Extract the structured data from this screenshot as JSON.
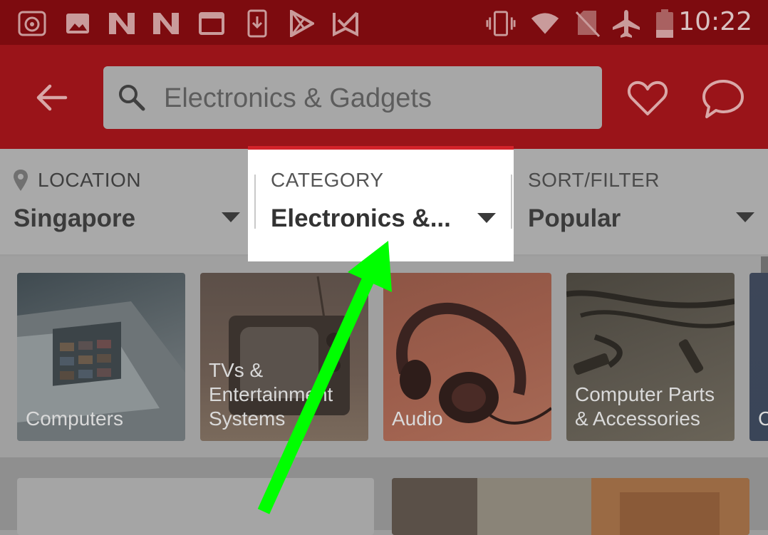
{
  "status_bar": {
    "time": "10:22",
    "left_icons": [
      "camera-app-icon",
      "image-icon",
      "n-icon",
      "n-icon",
      "window-icon",
      "download-icon",
      "play-store-icon",
      "check-icon"
    ],
    "right_icons": [
      "vibrate-icon",
      "wifi-icon",
      "no-sim-icon",
      "airplane-mode-icon",
      "battery-icon"
    ]
  },
  "app_bar": {
    "search_value": "Electronics & Gadgets"
  },
  "filters": {
    "location": {
      "label": "LOCATION",
      "value": "Singapore"
    },
    "category": {
      "label": "CATEGORY",
      "value": "Electronics &..."
    },
    "sort": {
      "label": "SORT/FILTER",
      "value": "Popular"
    }
  },
  "categories": [
    {
      "label": "Computers"
    },
    {
      "label": "TVs & Entertainment Systems"
    },
    {
      "label": "Audio"
    },
    {
      "label": "Computer Parts & Accessories"
    },
    {
      "label": "C"
    }
  ],
  "colors": {
    "status_bar": "#7d0b0f",
    "app_bar": "#9a1419",
    "highlight_accent": "#d4232a",
    "arrow": "#00ff00"
  }
}
